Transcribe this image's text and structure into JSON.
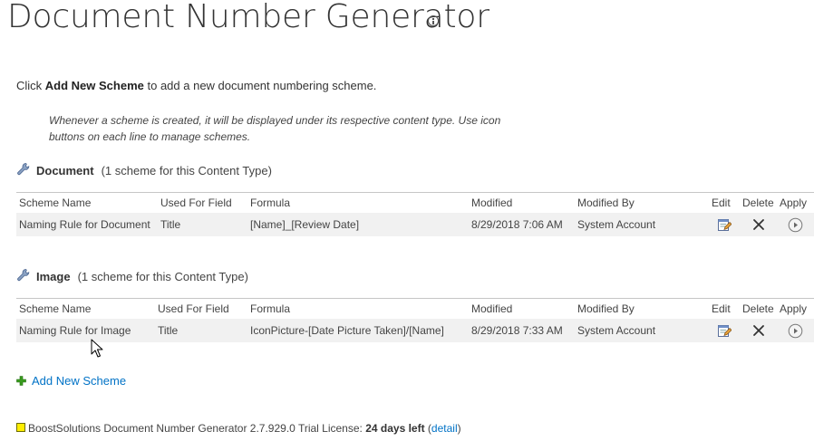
{
  "page": {
    "title": "Document Number Generator",
    "info_icon": "info-circle-icon"
  },
  "intro": {
    "prefix": "Click ",
    "bold": "Add New Scheme",
    "suffix": " to add a new document numbering scheme."
  },
  "note": "Whenever a scheme is created, it will be displayed under its respective content type. Use icon buttons on each line to manage schemes.",
  "columns": [
    "Scheme Name",
    "Used For Field",
    "Formula",
    "Modified",
    "Modified By",
    "Edit",
    "Delete",
    "Apply"
  ],
  "content_types": [
    {
      "name": "Document",
      "count_text": "(1 scheme for this Content Type)",
      "icon": "wrench-icon",
      "schemes": [
        {
          "scheme_name": "Naming Rule for Document",
          "used_for_field": "Title",
          "formula": "[Name]_[Review Date]",
          "modified": "8/29/2018 7:06 AM",
          "modified_by": "System Account"
        }
      ]
    },
    {
      "name": "Image",
      "count_text": "(1 scheme for this Content Type)",
      "icon": "wrench-icon",
      "schemes": [
        {
          "scheme_name": "Naming Rule for Image",
          "used_for_field": "Title",
          "formula": "IconPicture-[Date Picture Taken]/[Name]",
          "modified": "8/29/2018 7:33 AM",
          "modified_by": "System Account"
        }
      ]
    }
  ],
  "add_new_scheme": "Add New Scheme",
  "footer": {
    "product": "BoostSolutions Document Number Generator 2.7.929.0 Trial License: ",
    "days_left": "24 days left",
    "open_paren": " (",
    "detail_link": "detail",
    "close_paren": ")"
  },
  "colors": {
    "link": "#0072c6",
    "row_bg": "#f1f1f1",
    "add_icon": "#3a9c1f",
    "license_badge": "#ffee00"
  }
}
